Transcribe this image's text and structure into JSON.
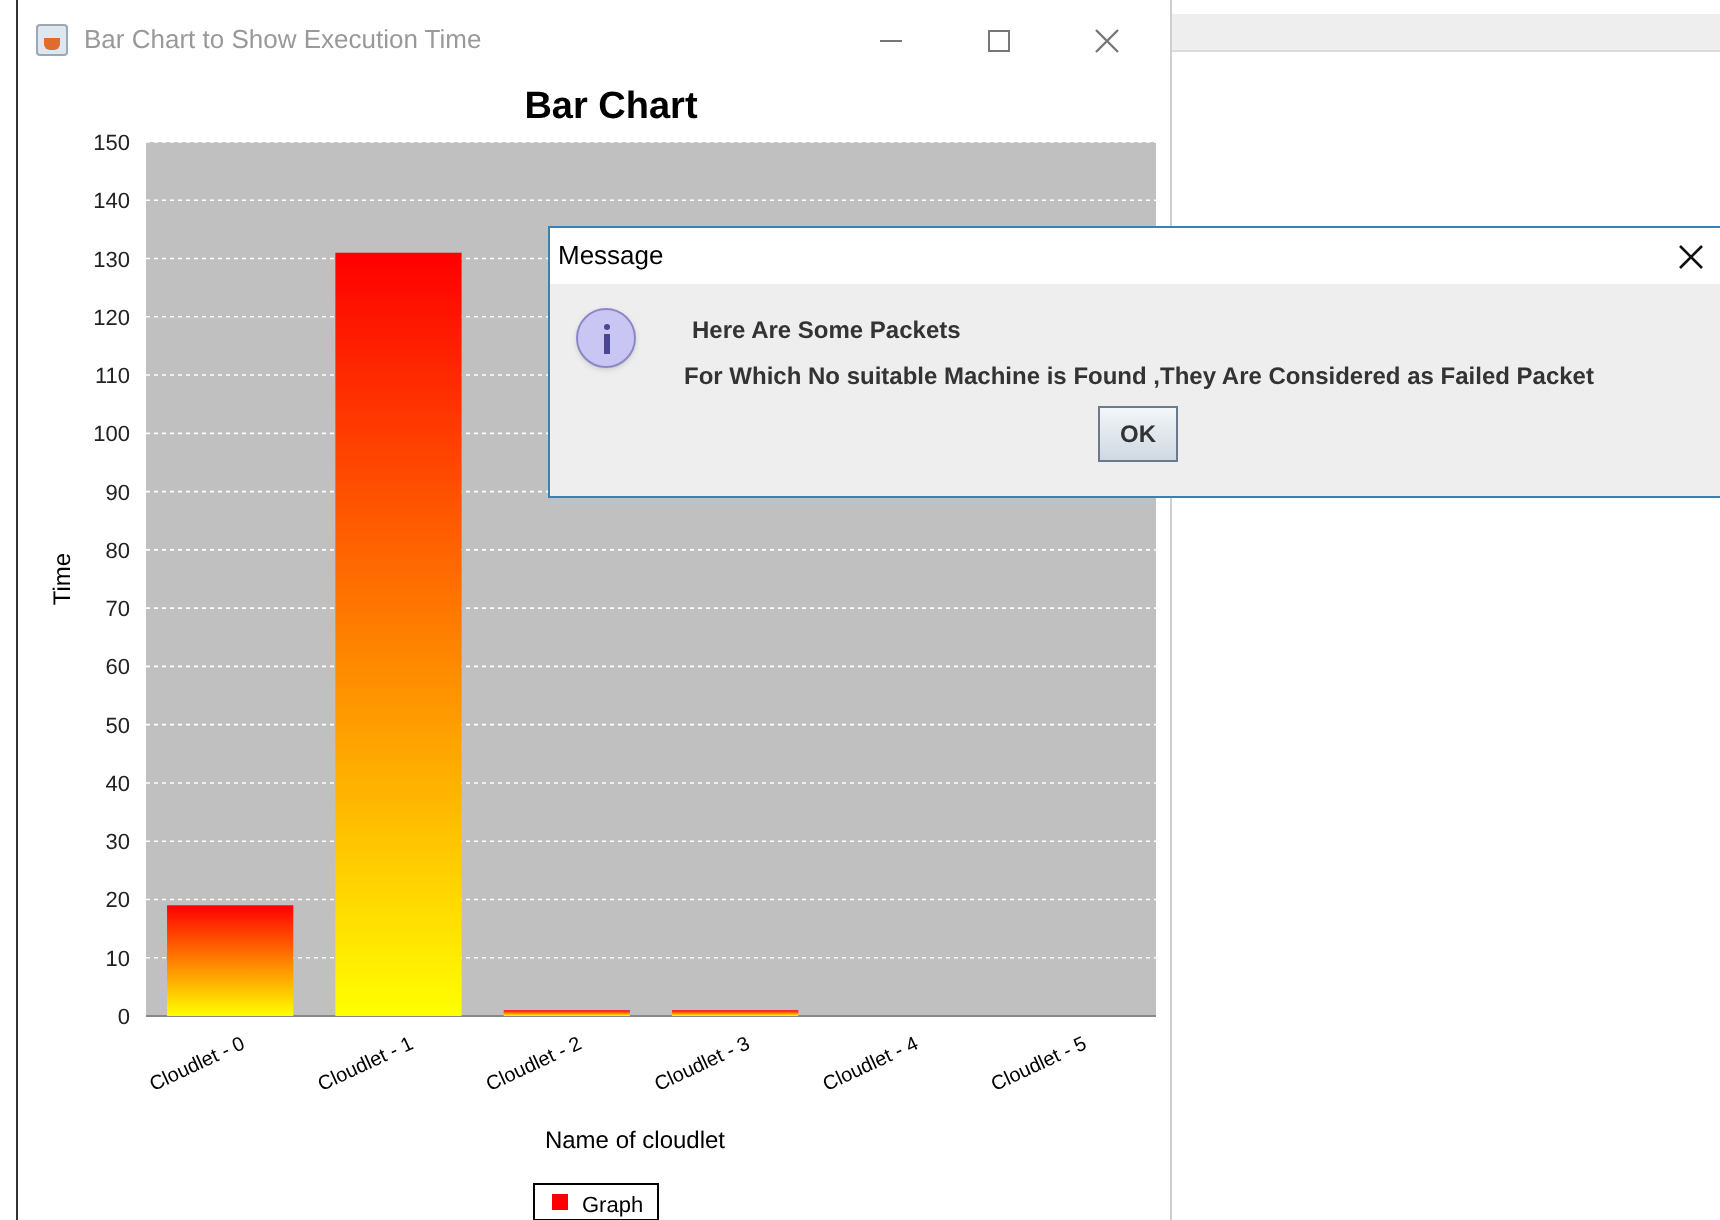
{
  "chart_window": {
    "title": "Bar Chart to Show Execution Time"
  },
  "chart_data": {
    "type": "bar",
    "title": "Bar Chart",
    "xlabel": "Name of cloudlet",
    "ylabel": "Time",
    "categories": [
      "Cloudlet - 0",
      "Cloudlet - 1",
      "Cloudlet - 2",
      "Cloudlet - 3",
      "Cloudlet - 4",
      "Cloudlet - 5"
    ],
    "series": [
      {
        "name": "Graph",
        "color": "#ff0000",
        "values": [
          19,
          131,
          1,
          1,
          0,
          0
        ]
      }
    ],
    "ylim": [
      0,
      150
    ],
    "grid": true,
    "yticks": [
      0,
      10,
      20,
      30,
      40,
      50,
      60,
      70,
      80,
      90,
      100,
      110,
      120,
      130,
      140,
      150
    ]
  },
  "dialog": {
    "title": "Message",
    "lines": [
      "Here Are Some Packets",
      "For Which No suitable Machine is Found ,They Are Considered as Failed Packet"
    ],
    "buttons": [
      "OK"
    ]
  }
}
